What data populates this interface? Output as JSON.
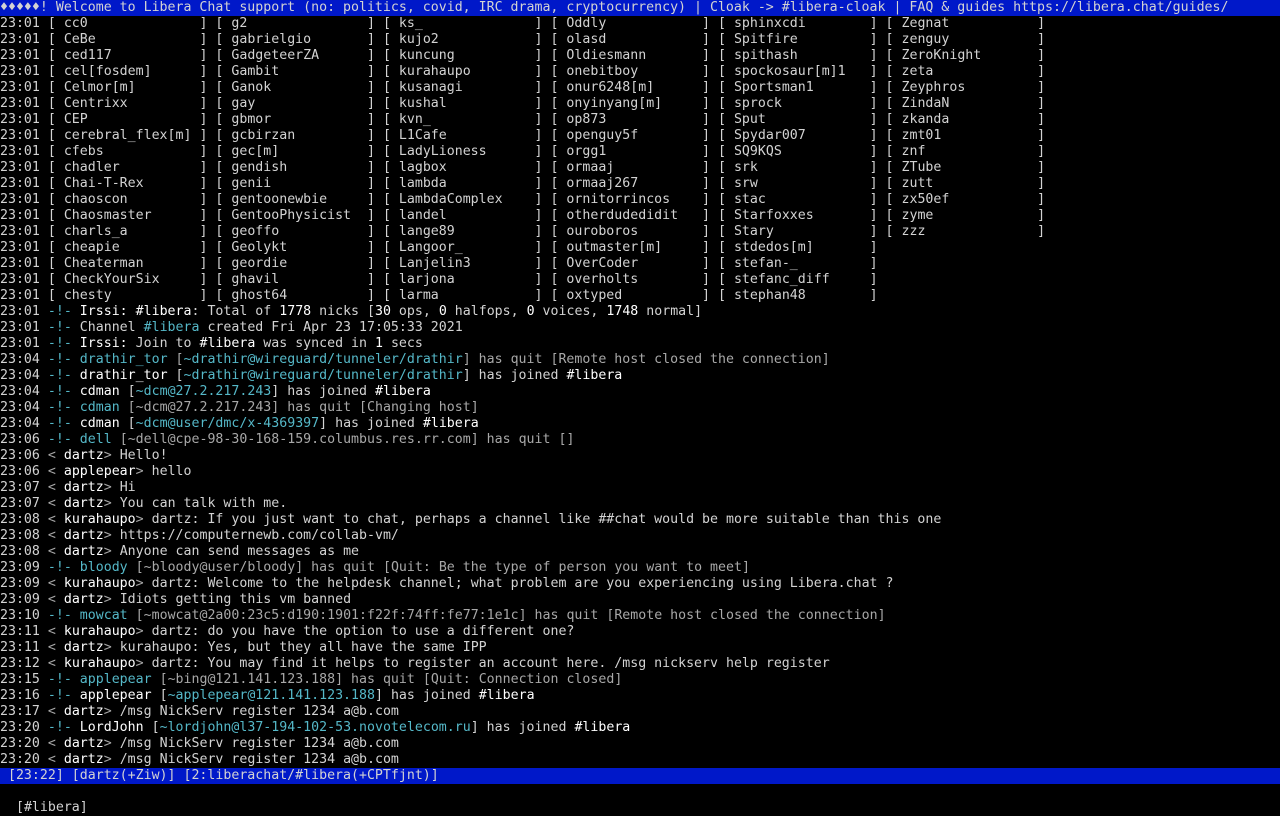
{
  "topic": "♦♦♦♦♦! Welcome to Libera Chat support (no: politics, covid, IRC drama, cryptocurrency) | Cloak -> #libera-cloak | FAQ & guides https://libera.chat/guides/",
  "nick_rows": [
    [
      "cc0",
      "g2",
      "ks_",
      "Oddly",
      "sphinxcdi",
      "Zegnat"
    ],
    [
      "CeBe",
      "gabrielgio",
      "kujo2",
      "olasd",
      "Spitfire",
      "zenguy"
    ],
    [
      "ced117",
      "GadgeteerZA",
      "kuncung",
      "Oldiesmann",
      "spithash",
      "ZeroKnight"
    ],
    [
      "cel[fosdem]",
      "Gambit",
      "kurahaupo",
      "onebitboy",
      "spockosaur[m]1",
      "zeta"
    ],
    [
      "Celmor[m]",
      "Ganok",
      "kusanagi",
      "onur6248[m]",
      "Sportsman1",
      "Zeyphros"
    ],
    [
      "Centrixx",
      "gay",
      "kushal",
      "onyinyang[m]",
      "sprock",
      "ZindaN"
    ],
    [
      "CEP",
      "gbmor",
      "kvn_",
      "op873",
      "Sput",
      "zkanda"
    ],
    [
      "cerebral_flex[m]",
      "gcbirzan",
      "L1Cafe",
      "openguy5f",
      "Spydar007",
      "zmt01"
    ],
    [
      "cfebs",
      "gec[m]",
      "LadyLioness",
      "orgg1",
      "SQ9KQS",
      "znf"
    ],
    [
      "chadler",
      "gendish",
      "lagbox",
      "ormaaj",
      "srk",
      "ZTube"
    ],
    [
      "Chai-T-Rex",
      "genii",
      "lambda",
      "ormaaj267",
      "srw",
      "zutt"
    ],
    [
      "chaoscon",
      "gentoonewbie",
      "LambdaComplex",
      "ornitorrincos",
      "stac",
      "zx50ef"
    ],
    [
      "Chaosmaster",
      "GentooPhysicist",
      "landel",
      "otherdudedidit",
      "Starfoxxes",
      "zyme"
    ],
    [
      "charls_a",
      "geoffo",
      "lange89",
      "ouroboros",
      "Stary",
      "zzz"
    ],
    [
      "cheapie",
      "Geolykt",
      "Langoor_",
      "outmaster[m]",
      "stdedos[m]",
      ""
    ],
    [
      "Cheaterman",
      "geordie",
      "Lanjelin3",
      "OverCoder",
      "stefan-_",
      ""
    ],
    [
      "CheckYourSix",
      "ghavil",
      "larjona",
      "overholts",
      "stefanc_diff",
      ""
    ],
    [
      "chesty",
      "ghost64",
      "larma",
      "oxtyped",
      "stephan48",
      ""
    ]
  ],
  "nick_time": "23:01",
  "events": [
    {
      "time": "23:01",
      "parts": [
        [
          "-!- ",
          "cyan"
        ],
        [
          "Irssi: ",
          "bold"
        ],
        [
          "#libera",
          "bold"
        ],
        [
          ": Total of ",
          ""
        ],
        [
          "1778",
          "bold"
        ],
        [
          " nicks [",
          ""
        ],
        [
          "30",
          "bold"
        ],
        [
          " ops, ",
          ""
        ],
        [
          "0",
          "bold"
        ],
        [
          " halfops, ",
          ""
        ],
        [
          "0",
          "bold"
        ],
        [
          " voices, ",
          ""
        ],
        [
          "1748",
          "bold"
        ],
        [
          " normal]",
          ""
        ]
      ]
    },
    {
      "time": "23:01",
      "parts": [
        [
          "-!- ",
          "cyan"
        ],
        [
          "Channel ",
          ""
        ],
        [
          "#libera",
          "cyan"
        ],
        [
          " created Fri Apr 23 17:05:33 2021",
          ""
        ]
      ]
    },
    {
      "time": "23:01",
      "parts": [
        [
          "-!- ",
          "cyan"
        ],
        [
          "Irssi: ",
          "bold"
        ],
        [
          "Join to ",
          ""
        ],
        [
          "#libera",
          "bold"
        ],
        [
          " was synced in ",
          ""
        ],
        [
          "1",
          "bold"
        ],
        [
          " secs",
          ""
        ]
      ]
    },
    {
      "time": "23:04",
      "parts": [
        [
          "-!- ",
          "cyan"
        ],
        [
          "drathir_tor",
          "cyan"
        ],
        [
          " [",
          "dim"
        ],
        [
          "~drathir@wireguard/tunneler/drathir",
          "cyan"
        ],
        [
          "] has quit [",
          "dim"
        ],
        [
          "Remote host closed the connection",
          "dim"
        ],
        [
          "]",
          "dim"
        ]
      ]
    },
    {
      "time": "23:04",
      "parts": [
        [
          "-!- ",
          "cyan"
        ],
        [
          "drathir_tor",
          "bold"
        ],
        [
          " [",
          ""
        ],
        [
          "~drathir@wireguard/tunneler/drathir",
          "cyan"
        ],
        [
          "] has joined ",
          ""
        ],
        [
          "#libera",
          "bold"
        ]
      ]
    },
    {
      "time": "23:04",
      "parts": [
        [
          "-!- ",
          "cyan"
        ],
        [
          "cdman",
          "bold"
        ],
        [
          " [",
          ""
        ],
        [
          "~dcm@27.2.217.243",
          "cyan"
        ],
        [
          "] has joined ",
          ""
        ],
        [
          "#libera",
          "bold"
        ]
      ]
    },
    {
      "time": "23:04",
      "parts": [
        [
          "-!- ",
          "cyan"
        ],
        [
          "cdman",
          "cyan"
        ],
        [
          " [",
          "dim"
        ],
        [
          "~dcm@27.2.217.243",
          "dim"
        ],
        [
          "] has quit [",
          "dim"
        ],
        [
          "Changing host",
          "dim"
        ],
        [
          "]",
          "dim"
        ]
      ]
    },
    {
      "time": "23:04",
      "parts": [
        [
          "-!- ",
          "cyan"
        ],
        [
          "cdman",
          "bold"
        ],
        [
          " [",
          ""
        ],
        [
          "~dcm@user/dmc/x-4369397",
          "cyan"
        ],
        [
          "] has joined ",
          ""
        ],
        [
          "#libera",
          "bold"
        ]
      ]
    },
    {
      "time": "23:06",
      "parts": [
        [
          "-!- ",
          "cyan"
        ],
        [
          "dell",
          "cyan"
        ],
        [
          " [",
          "dim"
        ],
        [
          "~dell@cpe-98-30-168-159.columbus.res.rr.com",
          "dim"
        ],
        [
          "] has quit []",
          "dim"
        ]
      ]
    },
    {
      "time": "23:06",
      "parts": [
        [
          "< ",
          "dim"
        ],
        [
          "dartz",
          "bold"
        ],
        [
          "> ",
          "dim"
        ],
        [
          "Hello!",
          ""
        ]
      ]
    },
    {
      "time": "23:06",
      "parts": [
        [
          "< ",
          "dim"
        ],
        [
          "applepear",
          "bold"
        ],
        [
          "> ",
          "dim"
        ],
        [
          "hello",
          ""
        ]
      ]
    },
    {
      "time": "23:07",
      "parts": [
        [
          "< ",
          "dim"
        ],
        [
          "dartz",
          "bold"
        ],
        [
          "> ",
          "dim"
        ],
        [
          "Hi",
          ""
        ]
      ]
    },
    {
      "time": "23:07",
      "parts": [
        [
          "< ",
          "dim"
        ],
        [
          "dartz",
          "bold"
        ],
        [
          "> ",
          "dim"
        ],
        [
          "You can talk with me.",
          ""
        ]
      ]
    },
    {
      "time": "23:08",
      "parts": [
        [
          "< ",
          "dim"
        ],
        [
          "kurahaupo",
          "bold"
        ],
        [
          "> ",
          "dim"
        ],
        [
          "dartz: If you just want to chat, perhaps a channel like ##chat would be more suitable than this one",
          ""
        ]
      ]
    },
    {
      "time": "23:08",
      "parts": [
        [
          "< ",
          "dim"
        ],
        [
          "dartz",
          "bold"
        ],
        [
          "> ",
          "dim"
        ],
        [
          "https://computernewb.com/collab-vm/",
          ""
        ]
      ]
    },
    {
      "time": "23:08",
      "parts": [
        [
          "< ",
          "dim"
        ],
        [
          "dartz",
          "bold"
        ],
        [
          "> ",
          "dim"
        ],
        [
          "Anyone can send messages as me",
          ""
        ]
      ]
    },
    {
      "time": "23:09",
      "parts": [
        [
          "-!- ",
          "cyan"
        ],
        [
          "bloody",
          "cyan"
        ],
        [
          " [",
          "dim"
        ],
        [
          "~bloody@user/bloody",
          "dim"
        ],
        [
          "] has quit [",
          "dim"
        ],
        [
          "Quit: Be the type of person you want to meet",
          "dim"
        ],
        [
          "]",
          "dim"
        ]
      ]
    },
    {
      "time": "23:09",
      "parts": [
        [
          "< ",
          "dim"
        ],
        [
          "kurahaupo",
          "bold"
        ],
        [
          "> ",
          "dim"
        ],
        [
          "dartz: Welcome to the helpdesk channel; what problem are you experiencing using Libera.chat ?",
          ""
        ]
      ]
    },
    {
      "time": "23:09",
      "parts": [
        [
          "< ",
          "dim"
        ],
        [
          "dartz",
          "bold"
        ],
        [
          "> ",
          "dim"
        ],
        [
          "Idiots getting this vm banned",
          ""
        ]
      ]
    },
    {
      "time": "23:10",
      "parts": [
        [
          "-!- ",
          "cyan"
        ],
        [
          "mowcat",
          "cyan"
        ],
        [
          " [",
          "dim"
        ],
        [
          "~mowcat@2a00:23c5:d190:1901:f22f:74ff:fe77:1e1c",
          "dim"
        ],
        [
          "] has quit [",
          "dim"
        ],
        [
          "Remote host closed the connection",
          "dim"
        ],
        [
          "]",
          "dim"
        ]
      ]
    },
    {
      "time": "23:11",
      "parts": [
        [
          "< ",
          "dim"
        ],
        [
          "kurahaupo",
          "bold"
        ],
        [
          "> ",
          "dim"
        ],
        [
          "dartz: do you have the option to use a different one?",
          ""
        ]
      ]
    },
    {
      "time": "23:11",
      "parts": [
        [
          "< ",
          "dim"
        ],
        [
          "dartz",
          "bold"
        ],
        [
          "> ",
          "dim"
        ],
        [
          "kurahaupo: Yes, but they all have the same IPP",
          ""
        ]
      ]
    },
    {
      "time": "23:12",
      "parts": [
        [
          "< ",
          "dim"
        ],
        [
          "kurahaupo",
          "bold"
        ],
        [
          "> ",
          "dim"
        ],
        [
          "dartz: You may find it helps to register an account here. /msg nickserv help register",
          ""
        ]
      ]
    },
    {
      "time": "23:15",
      "parts": [
        [
          "-!- ",
          "cyan"
        ],
        [
          "applepear",
          "cyan"
        ],
        [
          " [",
          "dim"
        ],
        [
          "~bing@121.141.123.188",
          "dim"
        ],
        [
          "] has quit [",
          "dim"
        ],
        [
          "Quit: Connection closed",
          "dim"
        ],
        [
          "]",
          "dim"
        ]
      ]
    },
    {
      "time": "23:16",
      "parts": [
        [
          "-!- ",
          "cyan"
        ],
        [
          "applepear",
          "bold"
        ],
        [
          " [",
          ""
        ],
        [
          "~applepear@121.141.123.188",
          "cyan"
        ],
        [
          "] has joined ",
          ""
        ],
        [
          "#libera",
          "bold"
        ]
      ]
    },
    {
      "time": "23:17",
      "parts": [
        [
          "< ",
          "dim"
        ],
        [
          "dartz",
          "bold"
        ],
        [
          "> ",
          "dim"
        ],
        [
          "/msg NickServ register 1234 a@b.com",
          ""
        ]
      ]
    },
    {
      "time": "23:20",
      "parts": [
        [
          "-!- ",
          "cyan"
        ],
        [
          "LordJohn",
          "bold"
        ],
        [
          " [",
          ""
        ],
        [
          "~lordjohn@l37-194-102-53.novotelecom.ru",
          "cyan"
        ],
        [
          "] has joined ",
          ""
        ],
        [
          "#libera",
          "bold"
        ]
      ]
    },
    {
      "time": "23:20",
      "parts": [
        [
          "< ",
          "dim"
        ],
        [
          "dartz",
          "bold"
        ],
        [
          "> ",
          "dim"
        ],
        [
          "/msg NickServ register 1234 a@b.com",
          ""
        ]
      ]
    },
    {
      "time": "23:20",
      "parts": [
        [
          "< ",
          "dim"
        ],
        [
          "dartz",
          "bold"
        ],
        [
          "> ",
          "dim"
        ],
        [
          "/msg NickServ register 1234 a@b.com",
          ""
        ]
      ]
    }
  ],
  "status": " [23:22] [dartz(+Ziw)] [2:liberachat/#libera(+CPTfjnt)]",
  "prompt": "[#libera]"
}
